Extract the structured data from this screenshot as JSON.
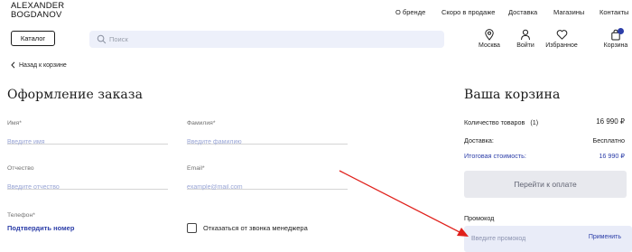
{
  "brand": {
    "line1": "ALEXANDER",
    "line2": "BOGDANOV"
  },
  "nav": {
    "about": "О бренде",
    "soon": "Скоро в продаже",
    "delivery": "Доставка",
    "shops": "Магазины",
    "contacts": "Контакты"
  },
  "catalog_button": "Каталог",
  "search": {
    "placeholder": "Поиск"
  },
  "header_icons": {
    "location": "Москва",
    "login": "Войти",
    "favorites": "Избранное",
    "cart": "Корзина"
  },
  "back_link": "Назад к корзине",
  "order": {
    "title": "Оформление заказа",
    "first_name": {
      "label": "Имя*",
      "placeholder": "Введите имя"
    },
    "last_name": {
      "label": "Фамилия*",
      "placeholder": "Введите фамилию"
    },
    "patronymic": {
      "label": "Отчество",
      "placeholder": "Введите отчество"
    },
    "email": {
      "label": "Email*",
      "placeholder": "example@mail.com"
    },
    "phone": {
      "label": "Телефон*",
      "confirm": "Подтвердить номер"
    },
    "no_call": "Отказаться от звонка менеджера"
  },
  "cart": {
    "title": "Ваша корзина",
    "items_label": "Количество товаров",
    "items_count": "(1)",
    "items_price": "16 990 ₽",
    "delivery_label": "Доставка:",
    "delivery_value": "Бесплатно",
    "total_label": "Итоговая стоимость:",
    "total_value": "16 990 ₽",
    "pay_button": "Перейти к оплате",
    "promo_label": "Промокод",
    "promo_placeholder": "Введите промокод",
    "apply": "Применить"
  },
  "colors": {
    "accent": "#2c3ea8",
    "arrow": "#e0201b",
    "search_bg": "#edf0fa"
  }
}
